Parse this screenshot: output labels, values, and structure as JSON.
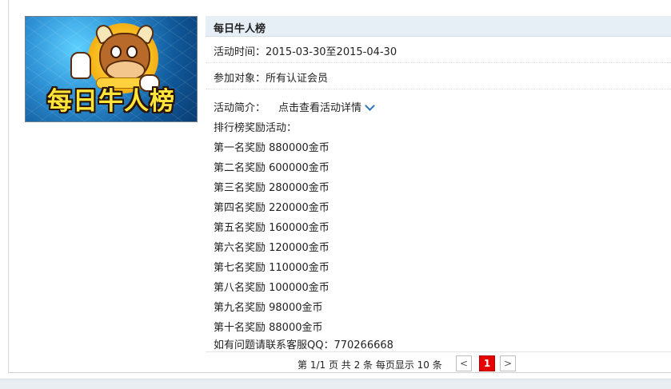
{
  "banner": {
    "title": "每日牛人榜"
  },
  "panel": {
    "title": "每日牛人榜",
    "time_label": "活动时间：2015-03-30至2015-04-30",
    "audience_label": "参加对象：所有认证会员",
    "intro_label": "活动简介：",
    "intro_link": "点击查看活动详情"
  },
  "rewards": {
    "heading": "排行榜奖励活动：",
    "items": [
      "第一名奖励 880000金币",
      "第二名奖励 600000金币",
      "第三名奖励 280000金币",
      "第四名奖励 220000金币",
      "第五名奖励 160000金币",
      "第六名奖励 120000金币",
      "第七名奖励 110000金币",
      "第八名奖励 100000金币",
      "第九名奖励 98000金币",
      "第十名奖励 88000金币"
    ],
    "contact": "如有问题请联系客服QQ：770266668"
  },
  "pager": {
    "info": "第 1/1 页 共 2 条 每页显示 10 条",
    "prev": "<",
    "current": "1",
    "next": ">"
  },
  "colors": {
    "header_bg": "#e6eef6",
    "current_page": "#e60000",
    "link_chevron": "#2b74c2"
  },
  "icons": [
    "chevron-down-icon"
  ]
}
